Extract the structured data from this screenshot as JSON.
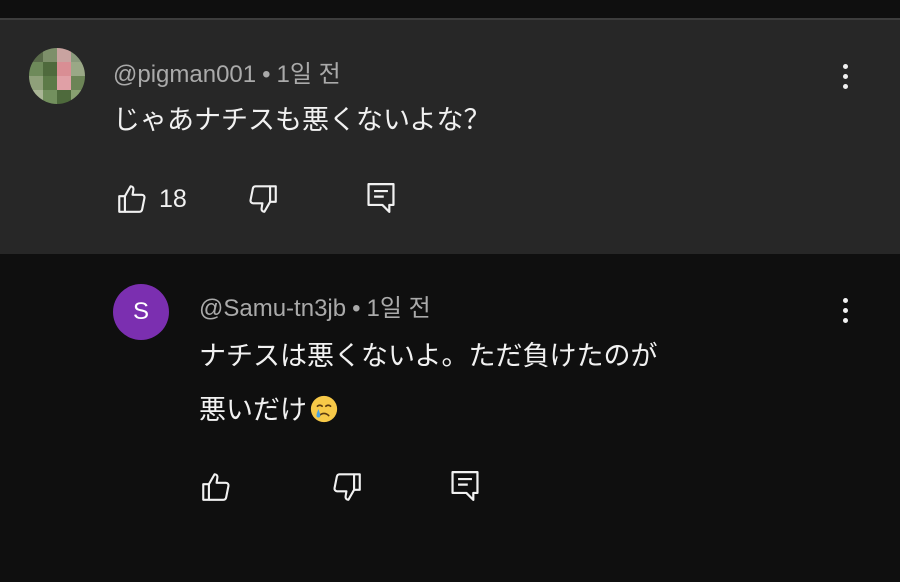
{
  "comments": [
    {
      "author": "@pigman001",
      "time": "1일 전",
      "text_lines": [
        "じゃあナチスも悪くないよな？"
      ],
      "like_count": "18"
    },
    {
      "author": "@Samu-tn3jb",
      "time": "1일 전",
      "avatar_letter": "S",
      "avatar_color": "#7b2fb0",
      "text_lines": [
        "ナチスは悪くないよ。ただ負けたのが",
        "悪いだけ"
      ],
      "like_count": ""
    }
  ],
  "separator": "•",
  "colors": {
    "parent_bg": "#272727",
    "reply_bg": "#0f0f0f",
    "meta_text": "#aaaaaa",
    "body_text": "#f1f1f1"
  },
  "icons": {
    "like": "thumbs-up-icon",
    "dislike": "thumbs-down-icon",
    "reply": "reply-comment-icon",
    "menu": "more-vert-icon",
    "emoji": "crying-face-emoji"
  }
}
